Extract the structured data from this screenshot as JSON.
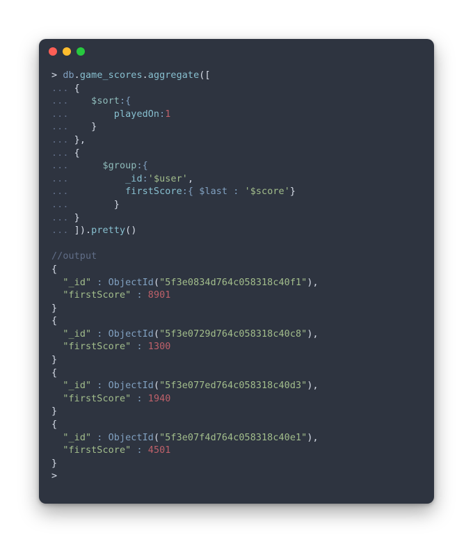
{
  "query": {
    "prompt": "> ",
    "dots": "...",
    "db": "db",
    "dot": ".",
    "coll": "game_scores",
    "agg": "aggregate",
    "openArr": "([",
    "openBrace": "{",
    "closeBrace": "}",
    "closeBraceComma": "},",
    "closeAll": "]).",
    "pretty": "pretty",
    "parens": "()",
    "sortKey": "$sort",
    "colonBrace": ":{",
    "colon": ":",
    "playedOn": "playedOn",
    "playedOnVal": "1",
    "groupKey": "$group",
    "idKey": "_id",
    "comma": ",",
    "userStr": "'$user'",
    "firstScoreKey": "firstScore",
    "lastOp": " $last ",
    "openBraceOnly": ":{",
    "spColon": " : ",
    "scoreStr": "'$score'",
    "closeBraceOnly": "}"
  },
  "output": {
    "comment": "//output",
    "idLabel": "\"_id\"",
    "colon": " : ",
    "objId": "ObjectId",
    "open": "(",
    "close": ")",
    "comma": ",",
    "fsLabel": "\"firstScore\"",
    "openBrace": "{",
    "closeBrace": "}",
    "rows": [
      {
        "oid": "\"5f3e0834d764c058318c40f1\"",
        "score": "8901"
      },
      {
        "oid": "\"5f3e0729d764c058318c40c8\"",
        "score": "1300"
      },
      {
        "oid": "\"5f3e077ed764c058318c40d3\"",
        "score": "1940"
      },
      {
        "oid": "\"5f3e07f4d764c058318c40e1\"",
        "score": "4501"
      }
    ],
    "finalPrompt": "> "
  }
}
